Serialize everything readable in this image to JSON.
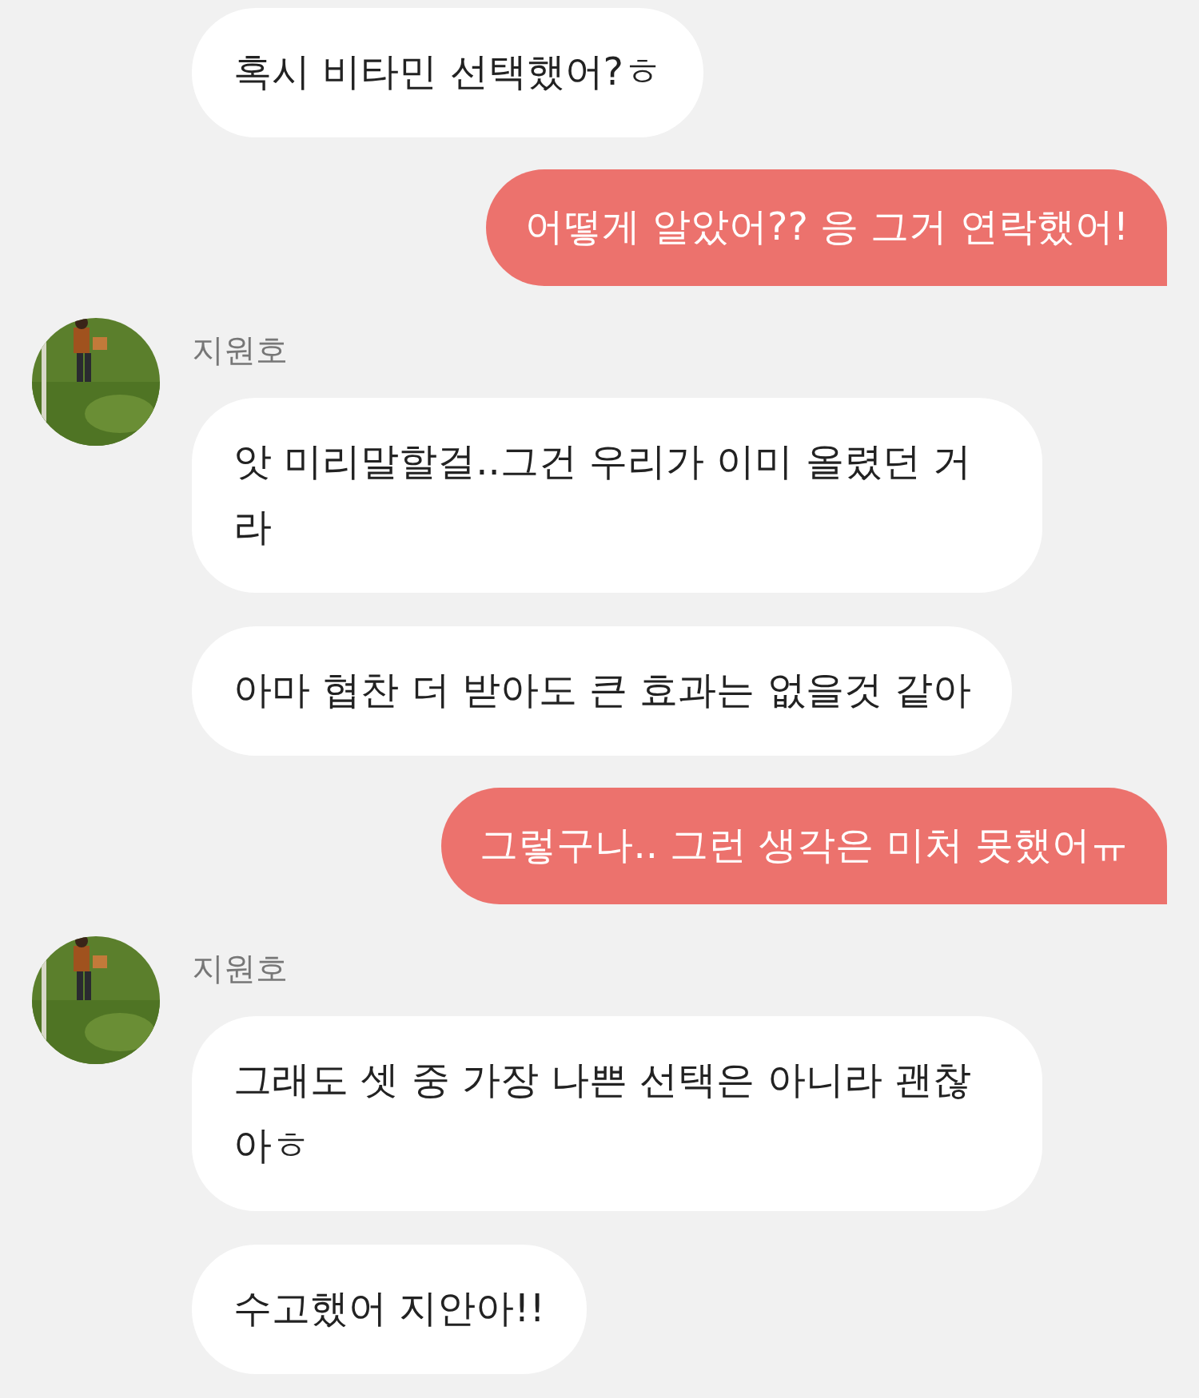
{
  "groups": [
    {
      "kind": "incoming",
      "messages": [
        "혹시 비타민 선택했어?ㅎ"
      ]
    },
    {
      "kind": "outgoing",
      "messages": [
        "어떻게 알았어?? 응 그거 연락했어!"
      ]
    },
    {
      "kind": "incoming",
      "sender": "지원호",
      "messages": [
        "앗 미리말할걸..그건 우리가 이미 올렸던 거라",
        "아마 협찬 더 받아도 큰 효과는 없을것 같아"
      ]
    },
    {
      "kind": "outgoing",
      "messages": [
        "그렇구나.. 그런 생각은 미처 못했어ㅠ"
      ]
    },
    {
      "kind": "incoming",
      "sender": "지원호",
      "messages": [
        "그래도 셋 중 가장 나쁜 선택은 아니라 괜찮아ㅎ",
        "수고했어 지안아!!"
      ]
    }
  ]
}
